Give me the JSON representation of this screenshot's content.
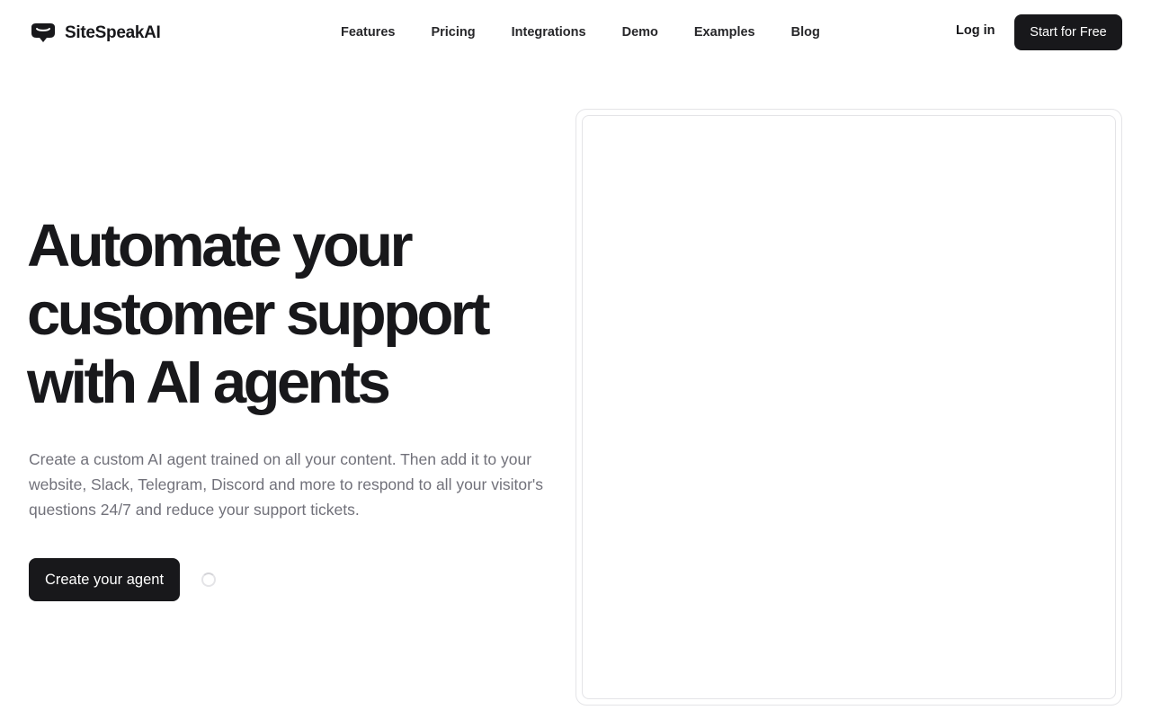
{
  "brand": {
    "name": "SiteSpeakAI",
    "logo_icon": "speech-bubble-logo-icon",
    "accent_color": "#18181b"
  },
  "nav": {
    "items": [
      {
        "label": "Features"
      },
      {
        "label": "Pricing"
      },
      {
        "label": "Integrations"
      },
      {
        "label": "Demo"
      },
      {
        "label": "Examples"
      },
      {
        "label": "Blog"
      }
    ],
    "login_label": "Log in",
    "cta_label": "Start for Free"
  },
  "hero": {
    "title_lines": [
      "Automate your",
      "customer support",
      "with AI agents"
    ],
    "subtitle": "Create a custom AI agent trained on all your content. Then add it to your website, Slack, Telegram, Discord and more to respond to all your visitor's questions 24/7 and reduce your support tickets.",
    "cta_label": "Create your agent",
    "loading_indicator": "spinner-icon"
  }
}
